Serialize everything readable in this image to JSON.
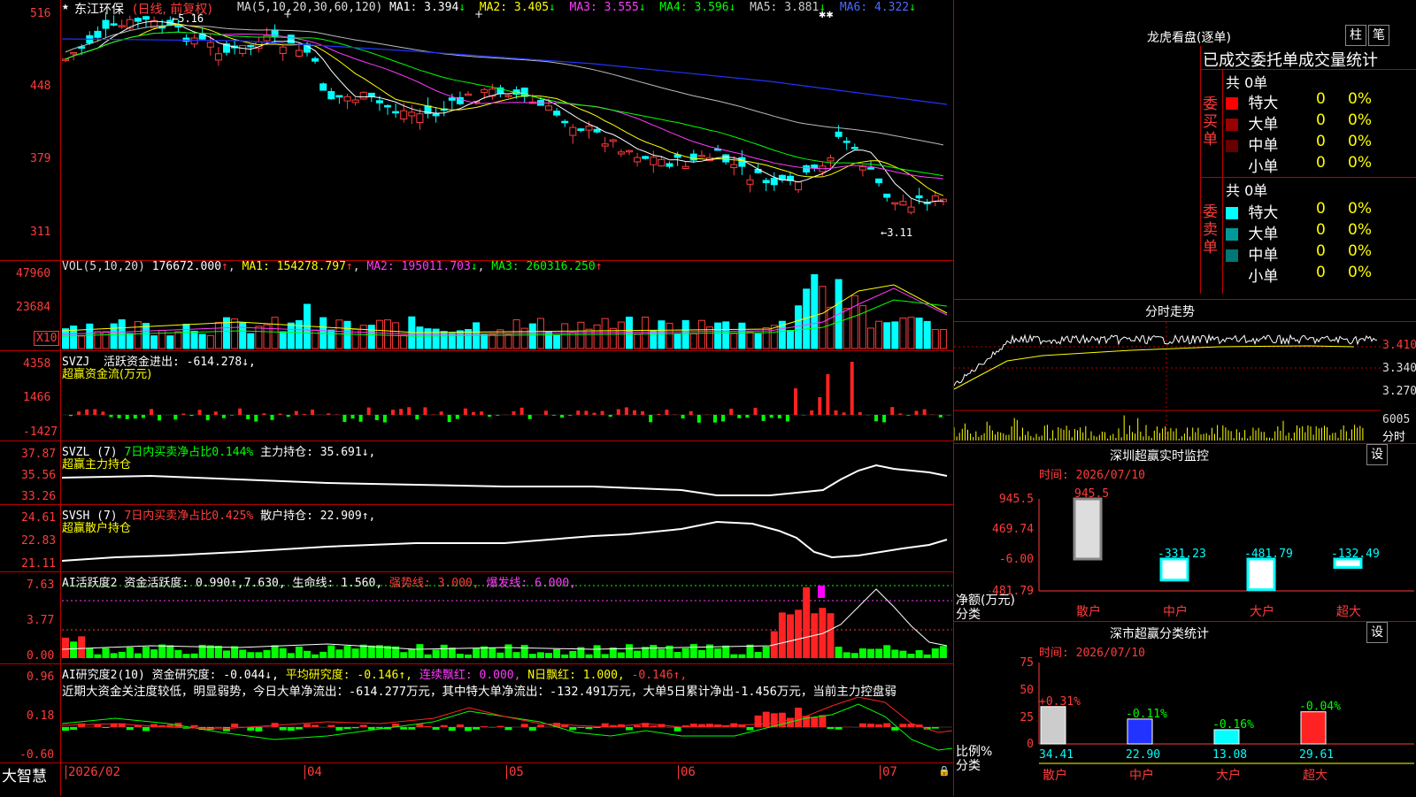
{
  "app_name": "大智慧",
  "stock": {
    "name": "东江环保",
    "period": "(日线, 前复权)"
  },
  "main_axis": [
    "516",
    "448",
    "379",
    "311"
  ],
  "high_marker": "5.16",
  "low_marker": "3.11",
  "ma": {
    "label": "MA(5,10,20,30,60,120)",
    "items": [
      {
        "name": "MA1",
        "value": "3.394",
        "dir": "↓",
        "color": "#ffffff"
      },
      {
        "name": "MA2",
        "value": "3.405",
        "dir": "↓",
        "color": "#ffff00"
      },
      {
        "name": "MA3",
        "value": "3.555",
        "dir": "↓",
        "color": "#ff3bff"
      },
      {
        "name": "MA4",
        "value": "3.596",
        "dir": "↓",
        "color": "#00ff00"
      },
      {
        "name": "MA5",
        "value": "3.881",
        "dir": "↓",
        "color": "#cccccc"
      },
      {
        "name": "MA6",
        "value": "4.322",
        "dir": "↓",
        "color": "#3b5bff"
      }
    ]
  },
  "vol": {
    "label": "VOL(5,10,20)",
    "value": "176672.000",
    "axis": [
      "47960",
      "23684"
    ],
    "unit": "X10",
    "ma1": "MA1: 154278.797",
    "ma2": "MA2: 195011.703",
    "ma3": "MA3: 260316.250"
  },
  "svzj": {
    "label": "SVZJ",
    "desc": "活跃资金进出: -614.278↓,",
    "sub": "超赢资金流(万元)",
    "axis": [
      "4358",
      "1466",
      "-1427"
    ]
  },
  "svzl": {
    "label": "SVZL (7)",
    "desc": "7日内买卖净占比0.144%",
    "desc2": "主力持仓: 35.691↓,",
    "sub": "超赢主力持仓",
    "axis": [
      "37.87",
      "35.56",
      "33.26"
    ]
  },
  "svsh": {
    "label": "SVSH (7)",
    "desc": "7日内买卖净占比0.425%",
    "desc2": "散户持仓: 22.909↑,",
    "sub": "超赢散户持仓",
    "axis": [
      "24.61",
      "22.83",
      "21.11"
    ]
  },
  "ai1": {
    "label": "AI活跃度2",
    "t1": "资金活跃度: 0.990↑,7.630,",
    "t2": "生命线: 1.560,",
    "t3": "强势线: 3.000,",
    "t4": "爆发线: 6.000,",
    "axis": [
      "7.63",
      "3.77",
      "0.00"
    ]
  },
  "ai2": {
    "label": "AI研究度2(10)",
    "t1": "资金研究度: -0.044↓,",
    "t2": "平均研究度: -0.146↑,",
    "t3": "连续飘红: 0.000,",
    "t4": "N日飘红: 1.000,",
    "t5": "-0.146↑,",
    "comment": "近期大资金关注度较低，明显弱势，今日大单净流出：-614.277万元，其中特大单净流出：-132.491万元，大单5日累计净出-1.456万元，当前主力控盘弱",
    "axis": [
      "0.96",
      "0.18",
      "-0.60"
    ]
  },
  "date_axis": [
    "2026/02",
    "04",
    "05",
    "06",
    "07"
  ],
  "longhu": {
    "title": "龙虎看盘(逐单)",
    "btn1": "柱",
    "btn2": "笔",
    "header": "已成交委托单成交量统计",
    "buy_label": "委买单",
    "sell_label": "委卖单",
    "buy_total": "共 0单",
    "sell_total": "共 0单",
    "buy_rows": [
      {
        "name": "特大",
        "count": "0",
        "pct": "0%",
        "color": "#ff0000"
      },
      {
        "name": "大单",
        "count": "0",
        "pct": "0%",
        "color": "#990000"
      },
      {
        "name": "中单",
        "count": "0",
        "pct": "0%",
        "color": "#660000"
      },
      {
        "name": "小单",
        "count": "0",
        "pct": "0%",
        "color": "#000000"
      }
    ],
    "sell_rows": [
      {
        "name": "特大",
        "count": "0",
        "pct": "0%",
        "color": "#00ffff"
      },
      {
        "name": "大单",
        "count": "0",
        "pct": "0%",
        "color": "#009999"
      },
      {
        "name": "中单",
        "count": "0",
        "pct": "0%",
        "color": "#007777"
      },
      {
        "name": "小单",
        "count": "0",
        "pct": "0%",
        "color": "#000000"
      }
    ]
  },
  "intraday": {
    "title": "分时走势",
    "axis": [
      "3.410",
      "3.340",
      "3.270"
    ],
    "vol_value": "6005",
    "vol_label": "分时"
  },
  "sz_monitor": {
    "title": "深圳超赢实时监控",
    "btn": "设",
    "time": "时间: 2026/07/10",
    "axis": [
      "945.5",
      "469.74",
      "-6.00",
      "-481.79"
    ],
    "ylabel": "净额(万元)",
    "xlabel": "分类",
    "bars": [
      {
        "name": "散户",
        "value": "945.5",
        "num": 945.5
      },
      {
        "name": "中户",
        "value": "-331.23",
        "num": -331.23
      },
      {
        "name": "大户",
        "value": "-481.79",
        "num": -481.79
      },
      {
        "name": "超大",
        "value": "-132.49",
        "num": -132.49
      }
    ]
  },
  "sz_class": {
    "title": "深市超赢分类统计",
    "btn": "设",
    "time": "时间: 2026/07/10",
    "axis": [
      "75",
      "50",
      "25",
      "0"
    ],
    "ylabel": "比例%",
    "xlabel": "分类",
    "bars": [
      {
        "name": "散户",
        "pct": "+0.31%",
        "value": "34.41",
        "num": 34.41,
        "color": "#cccccc"
      },
      {
        "name": "中户",
        "pct": "-0.11%",
        "value": "22.90",
        "num": 22.9,
        "color": "#2233ff"
      },
      {
        "name": "大户",
        "pct": "-0.16%",
        "value": "13.08",
        "num": 13.08,
        "color": "#00ffff"
      },
      {
        "name": "超大",
        "pct": "-0.04%",
        "value": "29.61",
        "num": 29.61,
        "color": "#ff2222"
      }
    ]
  }
}
